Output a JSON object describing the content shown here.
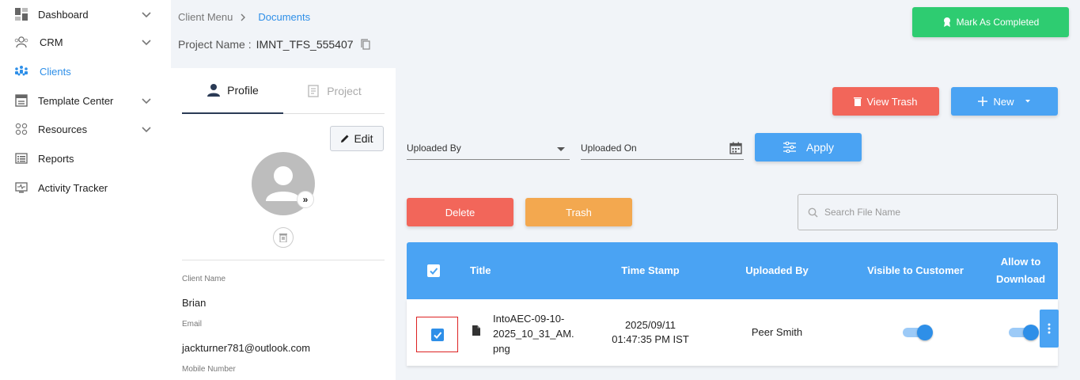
{
  "sidebar": {
    "items": [
      {
        "label": "Dashboard",
        "icon": "dashboard-icon"
      },
      {
        "label": "CRM",
        "icon": "crm-icon"
      },
      {
        "label": "Clients",
        "icon": "clients-icon"
      },
      {
        "label": "Template Center",
        "icon": "template-icon"
      },
      {
        "label": "Resources",
        "icon": "resources-icon"
      },
      {
        "label": "Reports",
        "icon": "reports-icon"
      },
      {
        "label": "Activity Tracker",
        "icon": "activity-icon"
      }
    ],
    "active": "Clients"
  },
  "breadcrumb": {
    "parent": "Client Menu",
    "current": "Documents"
  },
  "project": {
    "label": "Project Name :",
    "value": "IMNT_TFS_555407"
  },
  "header": {
    "complete_label": "Mark As Completed"
  },
  "profile_panel": {
    "tabs": {
      "profile": "Profile",
      "project": "Project"
    },
    "edit_label": "Edit",
    "fields": {
      "client_name_label": "Client Name",
      "client_name": "Brian",
      "email_label": "Email",
      "email": "jackturner781@outlook.com",
      "mobile_label": "Mobile Number"
    }
  },
  "actions": {
    "view_trash": "View Trash",
    "new": "New",
    "apply": "Apply",
    "delete": "Delete",
    "trash": "Trash"
  },
  "filters": {
    "uploaded_by": "Uploaded By",
    "uploaded_on": "Uploaded On"
  },
  "search": {
    "placeholder": "Search File Name"
  },
  "table": {
    "headers": {
      "title": "Title",
      "timestamp": "Time Stamp",
      "uploaded_by": "Uploaded By",
      "visible": "Visible to Customer",
      "allow_download_1": "Allow to",
      "allow_download_2": "Download"
    },
    "rows": [
      {
        "title_1": "IntoAEC-09-10-",
        "title_2": "2025_10_31_AM.",
        "title_3": "png",
        "date": "2025/09/11",
        "time": "01:47:35 PM IST",
        "uploaded_by": "Peer Smith",
        "selected": true,
        "visible_to_customer": true,
        "allow_download": true
      }
    ]
  },
  "colors": {
    "primary": "#4aa3f3",
    "danger": "#f2665a",
    "warning": "#f3a84f",
    "success": "#2ecc71"
  }
}
